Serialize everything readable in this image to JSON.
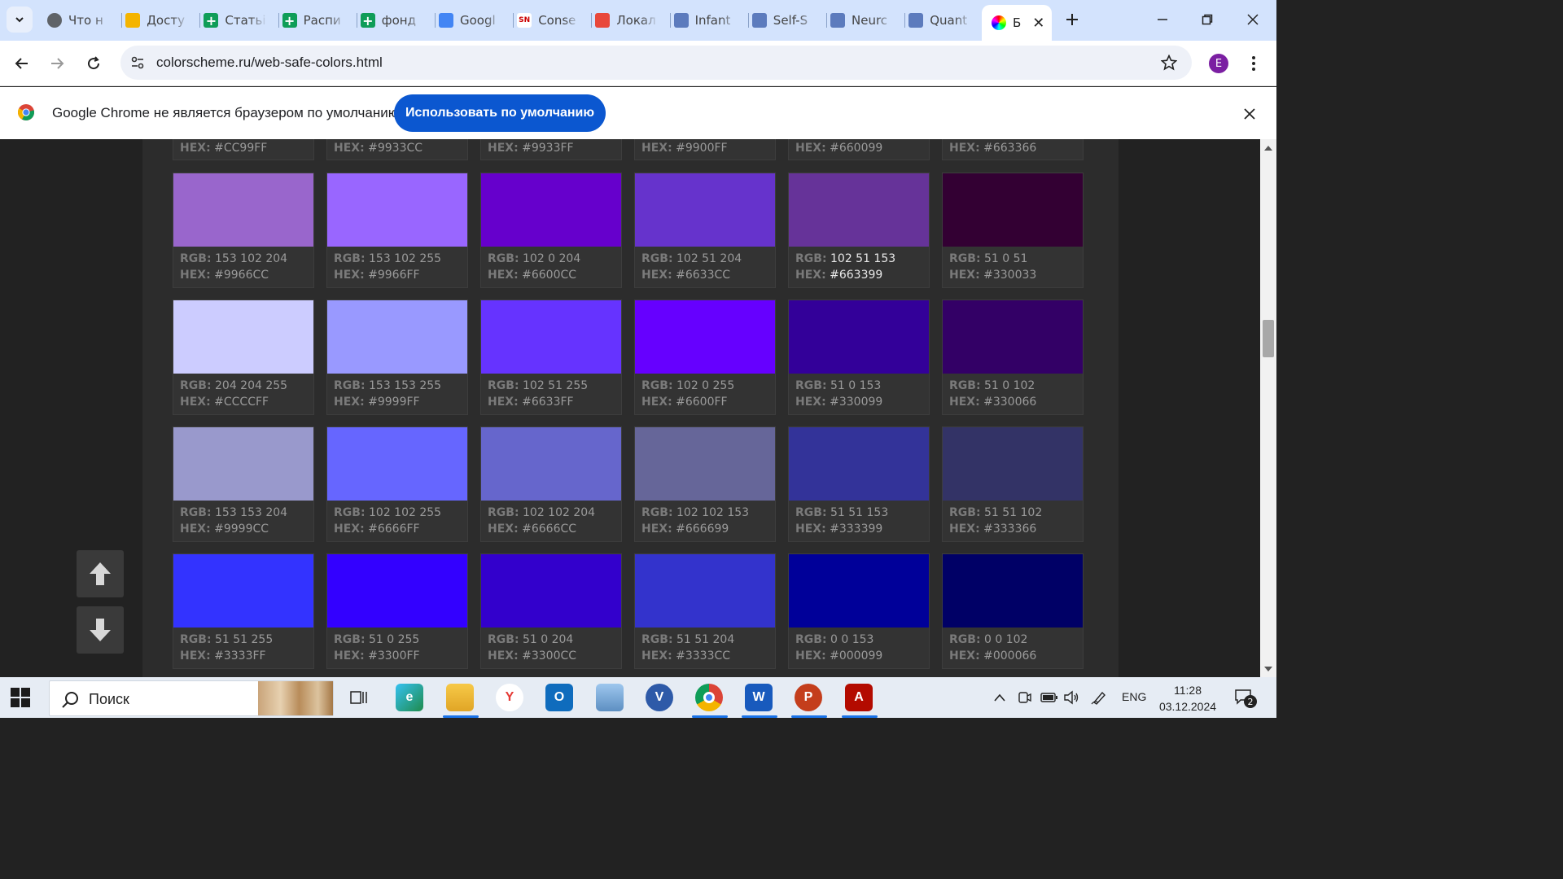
{
  "browser": {
    "tabs": [
      {
        "title": "Что н",
        "icon": "chrome-help-icon"
      },
      {
        "title": "Досту",
        "icon": "google-drive-icon"
      },
      {
        "title": "Статьі",
        "icon": "google-sheets-icon"
      },
      {
        "title": "Распи",
        "icon": "google-sheets-icon"
      },
      {
        "title": "фонд",
        "icon": "google-sheets-icon"
      },
      {
        "title": "Googl",
        "icon": "google-translate-icon"
      },
      {
        "title": "Conse",
        "icon": "sn-icon"
      },
      {
        "title": "Локал",
        "icon": "pen-icon"
      },
      {
        "title": "Infant",
        "icon": "document-icon"
      },
      {
        "title": "Self-S",
        "icon": "document-icon"
      },
      {
        "title": "Neurc",
        "icon": "document-icon"
      },
      {
        "title": "Quant",
        "icon": "document-icon"
      }
    ],
    "active_tab": {
      "title": "Б",
      "icon": "color-wheel-icon"
    },
    "url": "colorscheme.ru/web-safe-colors.html",
    "profile_initial": "E"
  },
  "infobar": {
    "message": "Google Chrome не является браузером по умолчанию.",
    "button_label": "Использовать по умолчанию"
  },
  "partial_row": [
    {
      "hex_label": "HEX:",
      "hex": "#CC99FF"
    },
    {
      "hex_label": "HEX:",
      "hex": "#9933CC"
    },
    {
      "hex_label": "HEX:",
      "hex": "#9933FF"
    },
    {
      "hex_label": "HEX:",
      "hex": "#9900FF"
    },
    {
      "hex_label": "HEX:",
      "hex": "#660099"
    },
    {
      "hex_label": "HEX:",
      "hex": "#663366"
    }
  ],
  "rows": [
    [
      {
        "rgb": "153 102 204",
        "hex": "#9966CC"
      },
      {
        "rgb": "153 102 255",
        "hex": "#9966FF"
      },
      {
        "rgb": "102 0 204",
        "hex": "#6600CC"
      },
      {
        "rgb": "102 51 204",
        "hex": "#6633CC"
      },
      {
        "rgb": "102 51 153",
        "hex": "#663399",
        "highlight": true
      },
      {
        "rgb": "51 0 51",
        "hex": "#330033"
      }
    ],
    [
      {
        "rgb": "204 204 255",
        "hex": "#CCCCFF"
      },
      {
        "rgb": "153 153 255",
        "hex": "#9999FF"
      },
      {
        "rgb": "102 51 255",
        "hex": "#6633FF"
      },
      {
        "rgb": "102 0 255",
        "hex": "#6600FF"
      },
      {
        "rgb": "51 0 153",
        "hex": "#330099"
      },
      {
        "rgb": "51 0 102",
        "hex": "#330066"
      }
    ],
    [
      {
        "rgb": "153 153 204",
        "hex": "#9999CC"
      },
      {
        "rgb": "102 102 255",
        "hex": "#6666FF"
      },
      {
        "rgb": "102 102 204",
        "hex": "#6666CC"
      },
      {
        "rgb": "102 102 153",
        "hex": "#666699"
      },
      {
        "rgb": "51 51 153",
        "hex": "#333399"
      },
      {
        "rgb": "51 51 102",
        "hex": "#333366"
      }
    ],
    [
      {
        "rgb": "51 51 255",
        "hex": "#3333FF"
      },
      {
        "rgb": "51 0 255",
        "hex": "#3300FF"
      },
      {
        "rgb": "51 0 204",
        "hex": "#3300CC"
      },
      {
        "rgb": "51 51 204",
        "hex": "#3333CC"
      },
      {
        "rgb": "0 0 153",
        "hex": "#000099"
      },
      {
        "rgb": "0 0 102",
        "hex": "#000066"
      }
    ]
  ],
  "labels": {
    "rgb": "RGB:",
    "hex": "HEX:"
  },
  "taskbar": {
    "search_placeholder": "Поиск",
    "apps": [
      "task-view-icon",
      "edge-icon",
      "file-explorer-icon",
      "yandex-browser-icon",
      "outlook-icon",
      "computer-icon",
      "viber-icon",
      "chrome-icon",
      "word-icon",
      "powerpoint-icon",
      "acrobat-icon"
    ],
    "language": "ENG",
    "time": "11:28",
    "date": "03.12.2024",
    "notification_count": "2"
  },
  "colors": {
    "accent": "#0b57d0",
    "page_bg": "#222222",
    "content_bg": "#2c2c2c",
    "tabstrip": "#d3e3fd"
  }
}
